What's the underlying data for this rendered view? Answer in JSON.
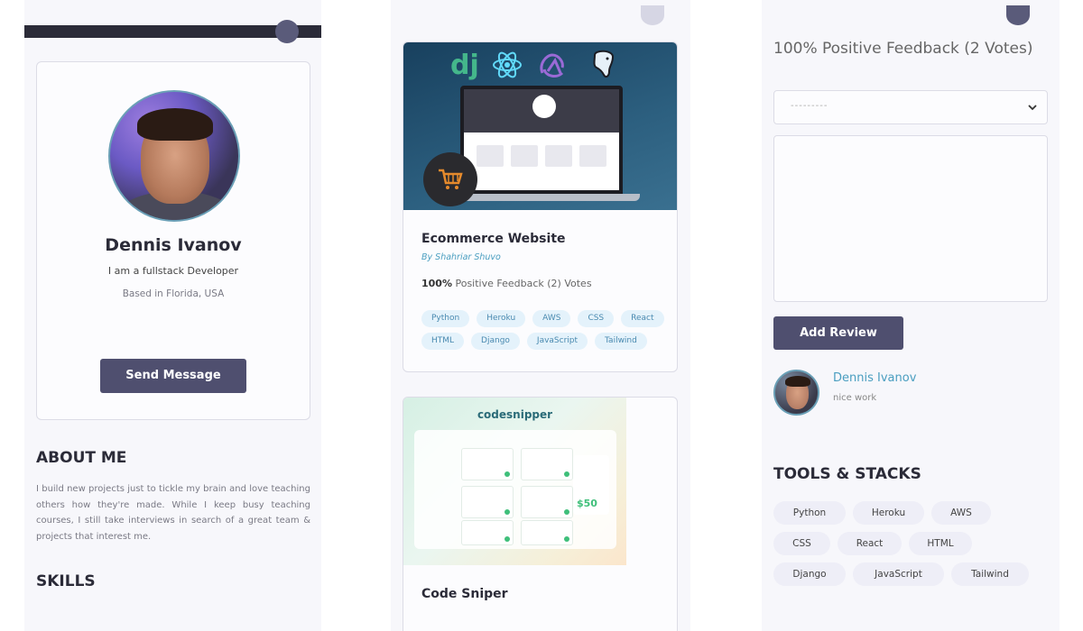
{
  "profile": {
    "name": "Dennis Ivanov",
    "role": "I am a fullstack Developer",
    "location": "Based in Florida, USA",
    "send_button": "Send Message"
  },
  "about": {
    "title": "ABOUT ME",
    "text": "I build new projects just to tickle my brain and love teaching others how they're made. While I keep busy teaching courses, I still take interviews in search of a great team & projects that interest me."
  },
  "skills": {
    "title": "SKILLS"
  },
  "projects": [
    {
      "title": "Ecommerce Website",
      "author": "By Shahriar Shuvo",
      "feedback_percent": "100%",
      "feedback_rest": "Positive Feedback (2) Votes",
      "tags": [
        "Python",
        "Heroku",
        "AWS",
        "CSS",
        "React",
        "HTML",
        "Django",
        "JavaScript",
        "Tailwind"
      ],
      "image_logo_text": "dj"
    },
    {
      "title": "Code Sniper",
      "image_logo_text": "codesnipper",
      "image_price": "$50"
    }
  ],
  "review_panel": {
    "feedback": "100% Positive Feedback (2 Votes)",
    "select_value": "---------",
    "add_button": "Add Review",
    "reviews": [
      {
        "name": "Dennis Ivanov",
        "text": "nice work"
      }
    ]
  },
  "tools": {
    "title": "TOOLS & STACKS",
    "items": [
      "Python",
      "Heroku",
      "AWS",
      "CSS",
      "React",
      "HTML",
      "Django",
      "JavaScript",
      "Tailwind"
    ]
  },
  "colors": {
    "primary_button": "#4f4f6f",
    "link": "#4a9ec0",
    "tag_bg": "#e4f2fb",
    "panel_bg": "#f7f7fb"
  }
}
